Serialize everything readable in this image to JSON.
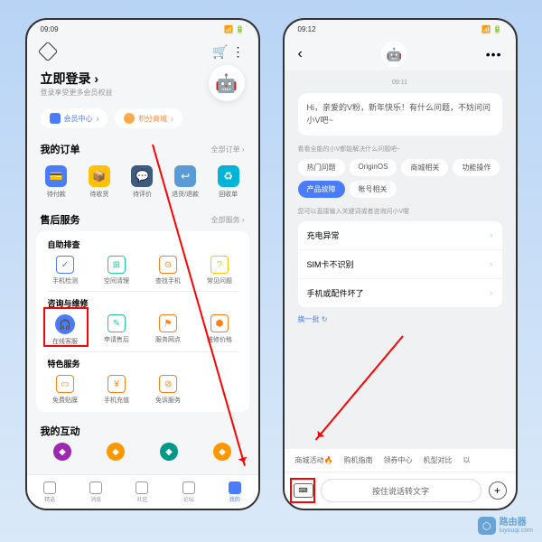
{
  "left": {
    "status_time": "09:09",
    "login_title": "立即登录",
    "login_chevron": "›",
    "login_sub": "登录享受更多会员权益",
    "pill_member": "会员中心",
    "pill_points": "积分商城",
    "orders_title": "我的订单",
    "orders_link": "全部订单 ›",
    "order_items": [
      {
        "icon": "💳",
        "label": "待付款",
        "color": "i-blue"
      },
      {
        "icon": "📦",
        "label": "待收货",
        "color": "i-yellow"
      },
      {
        "icon": "💬",
        "label": "待评价",
        "color": "i-darkblue"
      },
      {
        "icon": "↩",
        "label": "退货/退款",
        "color": "i-lightblue"
      },
      {
        "icon": "♻",
        "label": "回收单",
        "color": "i-cyan"
      }
    ],
    "service_title": "售后服务",
    "service_link": "全部服务 ›",
    "selfcheck_title": "自助排查",
    "selfcheck_items": [
      {
        "label": "手机检测",
        "cls": "oc-blue",
        "glyph": "✓"
      },
      {
        "label": "空间清理",
        "cls": "oc-teal",
        "glyph": "⊞"
      },
      {
        "label": "查找手机",
        "cls": "oc-orange",
        "glyph": "⊙"
      },
      {
        "label": "常见问题",
        "cls": "oc-yellow",
        "glyph": "?"
      }
    ],
    "consult_title": "咨询与维修",
    "consult_items": [
      {
        "label": "在线客服",
        "cls": "headset",
        "glyph": "🎧"
      },
      {
        "label": "申请售后",
        "cls": "oc-teal",
        "glyph": "✎"
      },
      {
        "label": "服务网点",
        "cls": "oc-orange",
        "glyph": "⚑"
      },
      {
        "label": "维修价格",
        "cls": "oc-orange",
        "glyph": "⬢"
      }
    ],
    "special_title": "特色服务",
    "special_items": [
      {
        "label": "免费贴膜",
        "cls": "oc-orange",
        "glyph": "▭"
      },
      {
        "label": "手机充值",
        "cls": "oc-orange",
        "glyph": "¥"
      },
      {
        "label": "免诉服务",
        "cls": "oc-orange",
        "glyph": "⊘"
      }
    ],
    "interact_title": "我的互动",
    "interact_colors": [
      "c-purple",
      "c-orange",
      "c-teal",
      "c-orange"
    ],
    "nav": [
      {
        "label": "精选"
      },
      {
        "label": "消息"
      },
      {
        "label": "社区"
      },
      {
        "label": "论坛"
      },
      {
        "label": "我的",
        "active": true
      }
    ]
  },
  "right": {
    "status_time": "09:12",
    "timestamp": "09:11",
    "greeting": "Hi，亲爱的V粉，新年快乐！有什么问题，不妨问问小V吧~",
    "hint1": "看看全能的小V都能解决什么问题吧~",
    "chips": [
      {
        "label": "热门问题"
      },
      {
        "label": "OriginOS"
      },
      {
        "label": "商城相关"
      },
      {
        "label": "功能操作"
      },
      {
        "label": "产品故障",
        "active": true
      },
      {
        "label": "帐号相关"
      }
    ],
    "hint2": "您可以直接输入关键词或者咨询问小V喔",
    "faq": [
      "充电异常",
      "SIM卡不识别",
      "手机或配件坏了"
    ],
    "refresh": "换一批 ↻",
    "topics": [
      "商城活动🔥",
      "购机指南",
      "领券中心",
      "机型对比",
      "以"
    ],
    "voice_placeholder": "按住说话转文字"
  },
  "watermark_cn": "路由器",
  "watermark_url": "luyouqi.com"
}
